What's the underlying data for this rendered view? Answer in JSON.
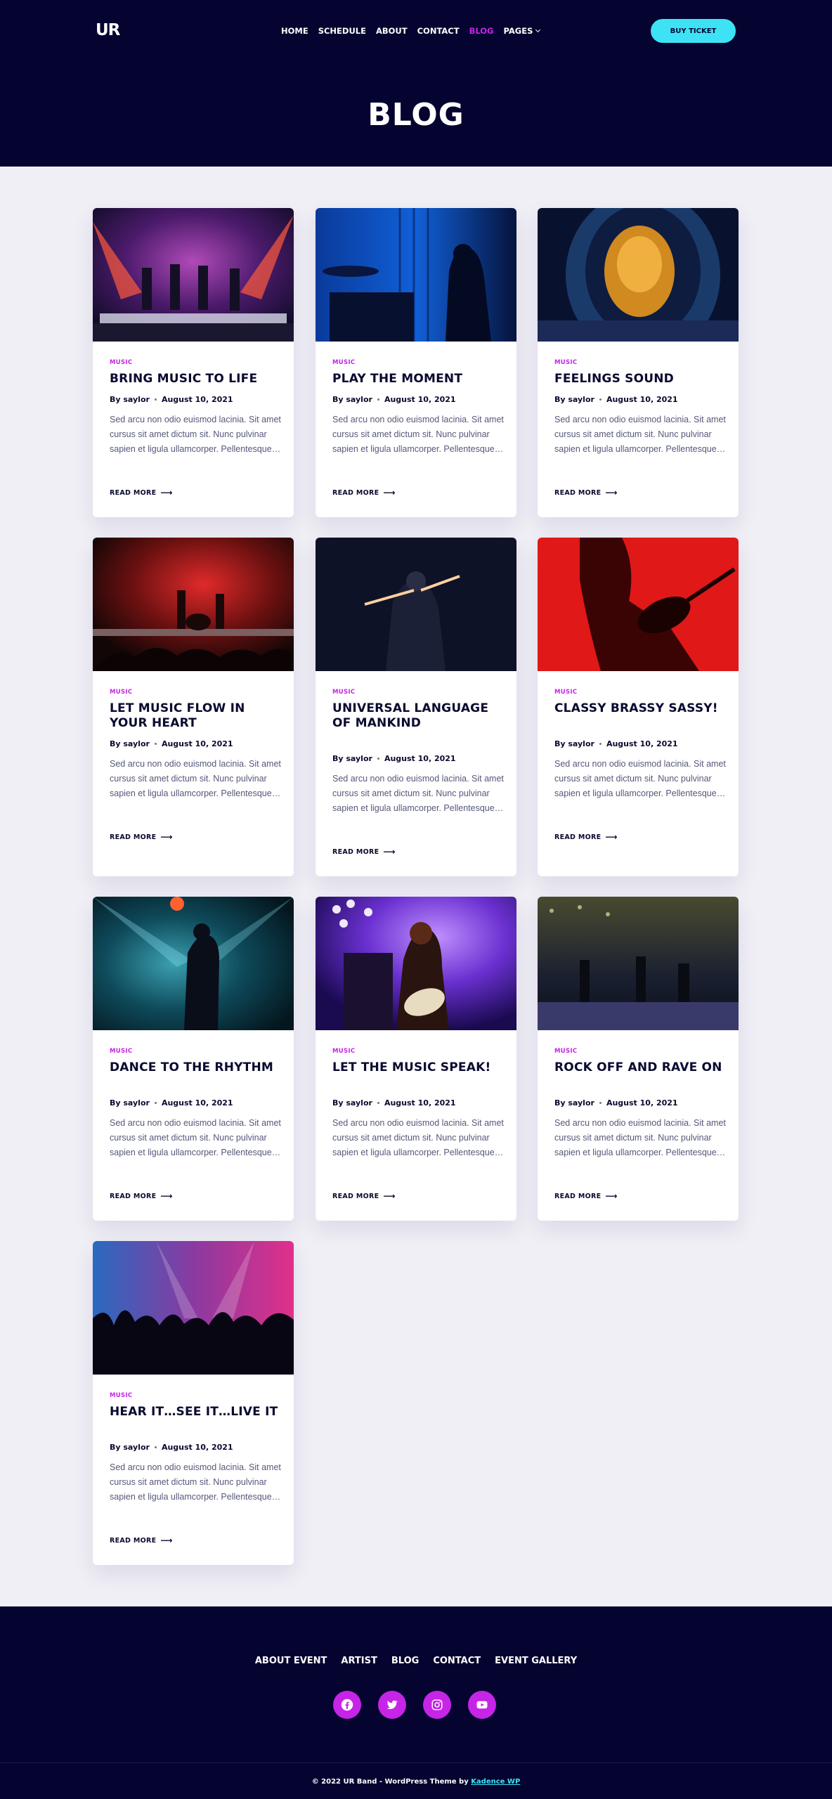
{
  "header": {
    "logo": "UR",
    "nav": [
      {
        "label": "HOME"
      },
      {
        "label": "SCHEDULE"
      },
      {
        "label": "ABOUT"
      },
      {
        "label": "CONTACT"
      },
      {
        "label": "BLOG",
        "active": true
      },
      {
        "label": "PAGES",
        "dropdown": true
      }
    ],
    "buy_button": "BUY TICKET",
    "page_title": "BLOG"
  },
  "posts": [
    {
      "category": "MUSIC",
      "title": "BRING MUSIC TO LIFE",
      "author": "By saylor",
      "date": "August 10, 2021",
      "excerpt": "Sed arcu non odio euismod lacinia. Sit amet cursus sit amet dictum sit. Nunc pulvinar sapien et ligula ullamcorper. Pellentesque…",
      "read_more": "READ MORE"
    },
    {
      "category": "MUSIC",
      "title": "PLAY THE MOMENT",
      "author": "By saylor",
      "date": "August 10, 2021",
      "excerpt": "Sed arcu non odio euismod lacinia. Sit amet cursus sit amet dictum sit. Nunc pulvinar sapien et ligula ullamcorper. Pellentesque…",
      "read_more": "READ MORE"
    },
    {
      "category": "MUSIC",
      "title": "FEELINGS SOUND",
      "author": "By saylor",
      "date": "August 10, 2021",
      "excerpt": "Sed arcu non odio euismod lacinia. Sit amet cursus sit amet dictum sit. Nunc pulvinar sapien et ligula ullamcorper. Pellentesque…",
      "read_more": "READ MORE"
    },
    {
      "category": "MUSIC",
      "title": "LET MUSIC FLOW IN YOUR HEART",
      "author": "By saylor",
      "date": "August 10, 2021",
      "excerpt": "Sed arcu non odio euismod lacinia. Sit amet cursus sit amet dictum sit. Nunc pulvinar sapien et ligula ullamcorper. Pellentesque…",
      "read_more": "READ MORE"
    },
    {
      "category": "MUSIC",
      "title": "UNIVERSAL LANGUAGE OF MANKIND",
      "author": "By saylor",
      "date": "August 10, 2021",
      "excerpt": "Sed arcu non odio euismod lacinia. Sit amet cursus sit amet dictum sit. Nunc pulvinar sapien et ligula ullamcorper. Pellentesque…",
      "read_more": "READ MORE"
    },
    {
      "category": "MUSIC",
      "title": "CLASSY BRASSY SASSY!",
      "author": "By saylor",
      "date": "August 10, 2021",
      "excerpt": "Sed arcu non odio euismod lacinia. Sit amet cursus sit amet dictum sit. Nunc pulvinar sapien et ligula ullamcorper. Pellentesque…",
      "read_more": "READ MORE"
    },
    {
      "category": "MUSIC",
      "title": "DANCE TO THE RHYTHM",
      "author": "By saylor",
      "date": "August 10, 2021",
      "excerpt": "Sed arcu non odio euismod lacinia. Sit amet cursus sit amet dictum sit. Nunc pulvinar sapien et ligula ullamcorper. Pellentesque…",
      "read_more": "READ MORE"
    },
    {
      "category": "MUSIC",
      "title": "LET THE MUSIC SPEAK!",
      "author": "By saylor",
      "date": "August 10, 2021",
      "excerpt": "Sed arcu non odio euismod lacinia. Sit amet cursus sit amet dictum sit. Nunc pulvinar sapien et ligula ullamcorper. Pellentesque…",
      "read_more": "READ MORE"
    },
    {
      "category": "MUSIC",
      "title": "ROCK OFF AND RAVE ON",
      "author": "By saylor",
      "date": "August 10, 2021",
      "excerpt": "Sed arcu non odio euismod lacinia. Sit amet cursus sit amet dictum sit. Nunc pulvinar sapien et ligula ullamcorper. Pellentesque…",
      "read_more": "READ MORE"
    },
    {
      "category": "MUSIC",
      "title": "HEAR IT…SEE IT…LIVE IT",
      "author": "By saylor",
      "date": "August 10, 2021",
      "excerpt": "Sed arcu non odio euismod lacinia. Sit amet cursus sit amet dictum sit. Nunc pulvinar sapien et ligula ullamcorper. Pellentesque…",
      "read_more": "READ MORE"
    }
  ],
  "footer": {
    "nav": [
      "ABOUT EVENT",
      "ARTIST",
      "BLOG",
      "CONTACT",
      "EVENT GALLERY"
    ],
    "social": [
      "facebook-icon",
      "twitter-icon",
      "instagram-icon",
      "youtube-icon"
    ],
    "copyright": "© 2022 UR Band - WordPress Theme by ",
    "theme_link": "Kadence WP"
  },
  "colors": {
    "header_bg": "#050430",
    "accent": "#c624e6",
    "button": "#3de3f5",
    "page_bg": "#f0eff6"
  }
}
